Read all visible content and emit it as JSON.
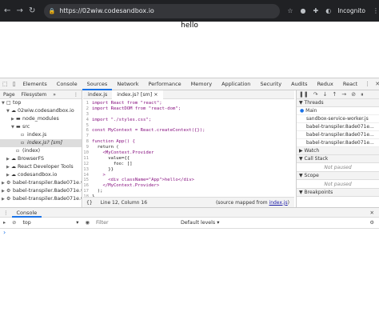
{
  "browser": {
    "url": "https://02wiw.codesandbox.io",
    "profile": "Incognito"
  },
  "page": {
    "hello_text": "hello"
  },
  "devtools": {
    "tabs": [
      "Elements",
      "Console",
      "Sources",
      "Network",
      "Performance",
      "Memory",
      "Application",
      "Security",
      "Audits",
      "Redux",
      "React"
    ],
    "active_tab": "Sources"
  },
  "navigator": {
    "tabs": [
      "Page",
      "Filesystem"
    ],
    "more": "»",
    "tree": [
      {
        "label": "top",
        "depth": 0,
        "twisty": "▼",
        "icon": "□"
      },
      {
        "label": "02wiw.codesandbox.io",
        "depth": 1,
        "twisty": "▼",
        "icon": "☁"
      },
      {
        "label": "node_modules",
        "depth": 2,
        "twisty": "▶",
        "icon": "▬"
      },
      {
        "label": "src",
        "depth": 2,
        "twisty": "▼",
        "icon": "▬"
      },
      {
        "label": "index.js",
        "depth": 3,
        "twisty": "",
        "icon": "▫"
      },
      {
        "label": "index.js? [sm]",
        "depth": 3,
        "twisty": "",
        "icon": "▫",
        "selected": true
      },
      {
        "label": "(index)",
        "depth": 2,
        "twisty": "",
        "icon": "▫"
      },
      {
        "label": "BrowserFS",
        "depth": 1,
        "twisty": "▶",
        "icon": "☁"
      },
      {
        "label": "React Developer Tools",
        "depth": 1,
        "twisty": "▶",
        "icon": "☁"
      },
      {
        "label": "codesandbox.io",
        "depth": 1,
        "twisty": "▶",
        "icon": "☁"
      },
      {
        "label": "babel-transpiler.8ade071e.worker",
        "depth": 0,
        "twisty": "▶",
        "icon": "⚙"
      },
      {
        "label": "babel-transpiler.8ade071e.worker",
        "depth": 0,
        "twisty": "▶",
        "icon": "⚙"
      },
      {
        "label": "babel-transpiler.8ade071e.worker",
        "depth": 0,
        "twisty": "▶",
        "icon": "⚙"
      }
    ]
  },
  "editor": {
    "tabs": [
      {
        "label": "index.js",
        "active": false
      },
      {
        "label": "index.js? [sm]",
        "active": true,
        "close": "×"
      }
    ],
    "lines": [
      {
        "n": "1",
        "text": "import React from \"react\";"
      },
      {
        "n": "2",
        "text": "import ReactDOM from \"react-dom\";"
      },
      {
        "n": "3",
        "text": ""
      },
      {
        "n": "4",
        "text": "import \"./styles.css\";"
      },
      {
        "n": "5",
        "text": ""
      },
      {
        "n": "6",
        "text": "const MyContext = React.createContext({});"
      },
      {
        "n": "7",
        "text": ""
      },
      {
        "n": "8",
        "text": "function App() {"
      },
      {
        "n": "9",
        "text": "  return ("
      },
      {
        "n": "10",
        "text": "    <MyContext.Provider"
      },
      {
        "n": "11",
        "text": "      value={{"
      },
      {
        "n": "12",
        "text": "        foo: []"
      },
      {
        "n": "13",
        "text": "      }}"
      },
      {
        "n": "14",
        "text": "    >"
      },
      {
        "n": "15",
        "text": "      <div className=\"App\">hello</div>"
      },
      {
        "n": "16",
        "text": "    </MyContext.Provider>"
      },
      {
        "n": "17",
        "text": "  );"
      },
      {
        "n": "18",
        "text": "}"
      }
    ],
    "status_position": "Line 12, Column 16",
    "status_source_prefix": "(source mapped from ",
    "status_source_link": "index.js",
    "status_source_suffix": ")"
  },
  "debugger": {
    "threads_label": "Threads",
    "threads": [
      {
        "label": "Main",
        "main": true
      },
      {
        "label": "sandbox-service-worker.js"
      },
      {
        "label": "babel-transpiler.8ade071e..."
      },
      {
        "label": "babel-transpiler.8ade071e..."
      },
      {
        "label": "babel-transpiler.8ade071e..."
      }
    ],
    "watch_label": "Watch",
    "callstack_label": "Call Stack",
    "callstack_empty": "Not paused",
    "scope_label": "Scope",
    "scope_empty": "Not paused",
    "breakpoints_label": "Breakpoints"
  },
  "console": {
    "title": "Console",
    "context": "top",
    "filter_placeholder": "Filter",
    "levels": "Default levels ▾",
    "prompt": "›"
  }
}
